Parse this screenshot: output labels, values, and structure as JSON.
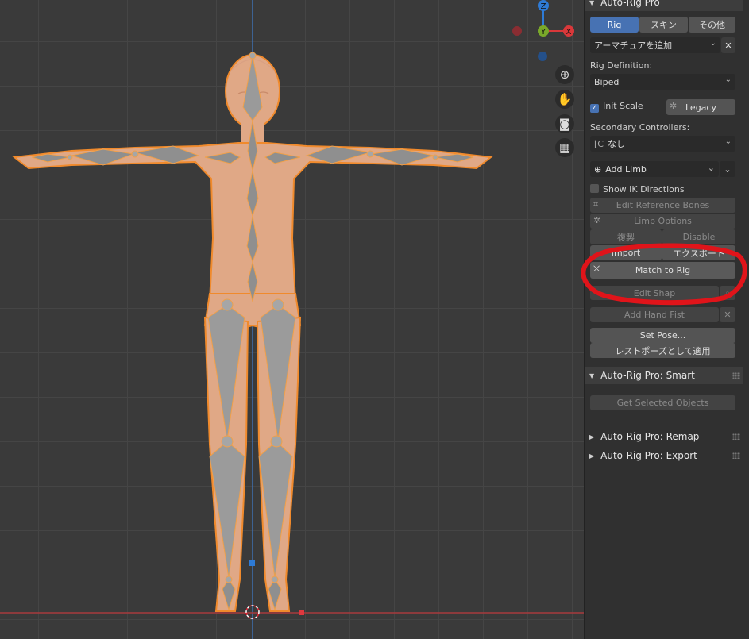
{
  "viewport": {
    "gizmo": {
      "z_label": "Z",
      "y_label": "Y",
      "x_label": "X"
    },
    "nav_icons": [
      "zoom-icon",
      "hand-icon",
      "camera-icon",
      "grid-icon"
    ]
  },
  "panel": {
    "title": "Auto-Rig Pro",
    "tabs": [
      "Rig",
      "スキン",
      "その他"
    ],
    "armature_dropdown": "アーマチュアを追加",
    "rig_definition_label": "Rig Definition:",
    "rig_definition_value": "Biped",
    "init_scale_label": "Init Scale",
    "init_scale_checked": true,
    "legacy_label": "Legacy",
    "secondary_label": "Secondary Controllers:",
    "secondary_value": "なし",
    "add_limb_label": "Add Limb",
    "show_ik_label": "Show IK Directions",
    "show_ik_checked": false,
    "edit_ref_bones": "Edit Reference Bones",
    "limb_options": "Limb Options",
    "duplicate": "複製",
    "disable": "Disable",
    "import": "Import",
    "export": "エクスポート",
    "match_to_rig": "Match to Rig",
    "edit_shape": "Edit Shap",
    "add_hand_fist": "Add Hand Fist",
    "set_pose": "Set Pose...",
    "apply_rest_pose": "レストポーズとして適用",
    "smart_header": "Auto-Rig Pro: Smart",
    "get_selected_objects": "Get Selected Objects",
    "remap_header": "Auto-Rig Pro: Remap",
    "export_header": "Auto-Rig Pro: Export"
  },
  "colors": {
    "accent_blue": "#4772b3",
    "selection_orange": "#f08a2c",
    "annotation_red": "#e0141a",
    "axis_red": "#d9383a",
    "axis_green": "#7aa82a",
    "axis_blue": "#2e7bd6"
  }
}
